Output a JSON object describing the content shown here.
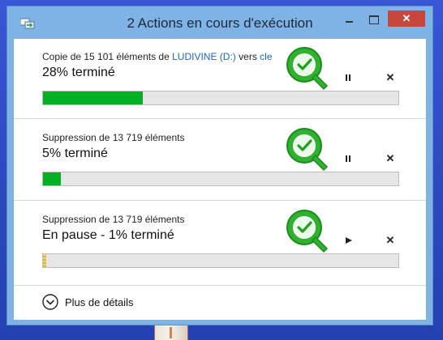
{
  "window": {
    "title": "2 Actions en cours d'exécution",
    "close_glyph": "✕"
  },
  "operations": [
    {
      "desc_prefix": "Copie de 15 101 éléments de ",
      "desc_link": "LUDIVINE (D:)",
      "desc_middle": " vers ",
      "desc_link2": "cle",
      "status": "28% terminé",
      "progress": 0.28,
      "state": "running"
    },
    {
      "desc_prefix": "Suppression de 13 719 éléments",
      "status": "5% terminé",
      "progress": 0.05,
      "state": "running"
    },
    {
      "desc_prefix": "Suppression de 13 719 éléments",
      "status": "En pause - 1% terminé",
      "progress": 0.01,
      "state": "paused"
    }
  ],
  "details": {
    "label": "Plus de détails"
  },
  "cancel_glyph": "✕",
  "colors": {
    "progress_green": "#06b025",
    "progress_paused": "#e8c85a",
    "link_blue": "#1f63c4",
    "close_red": "#c7473d",
    "badge_green": "#2fb32f"
  },
  "icons": {
    "title_app": "file-transfer-icon",
    "pause": "pause-icon",
    "resume": "play-icon",
    "cancel": "close-icon",
    "badge": "checkmark-badge-icon",
    "details": "chevron-down-circle-icon"
  }
}
